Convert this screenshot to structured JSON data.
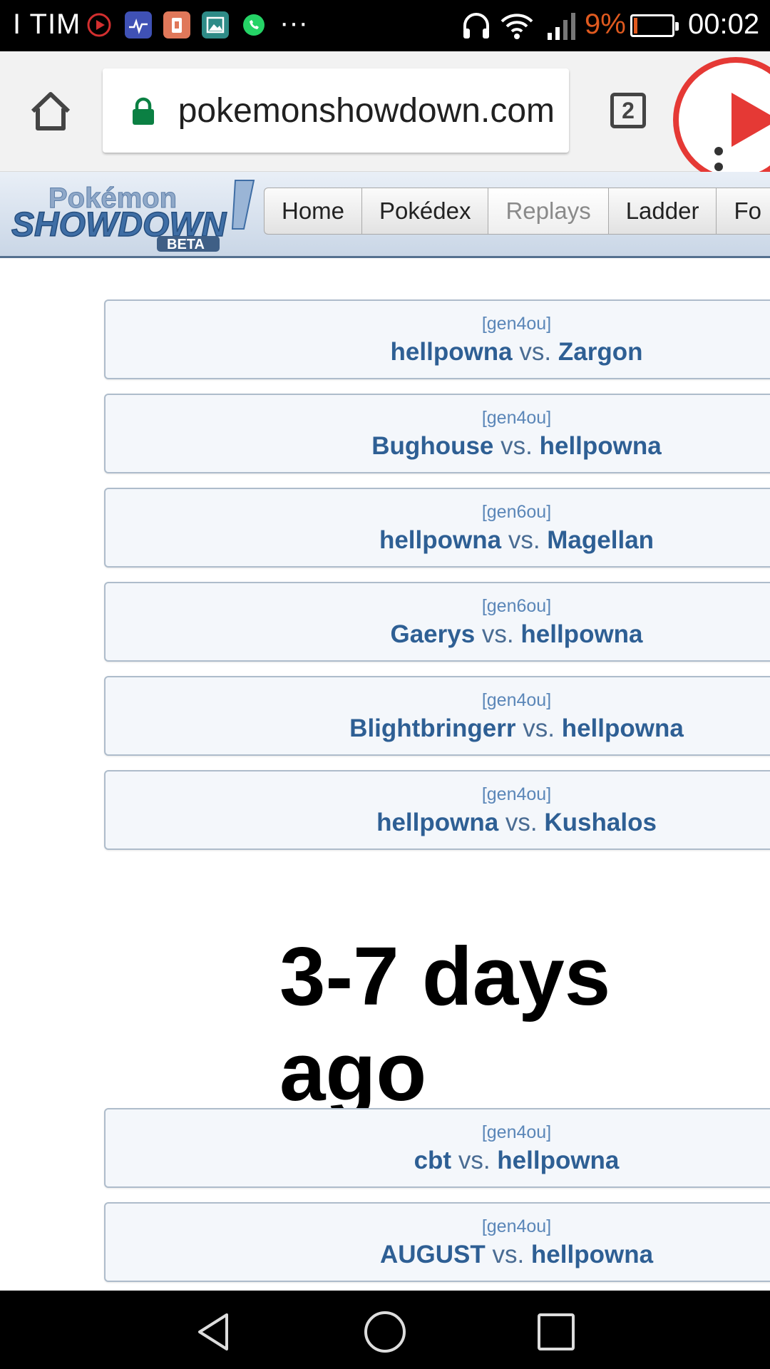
{
  "status_bar": {
    "carrier": "I TIM",
    "notification_icons": [
      "youtube-icon",
      "health-icon",
      "clipboard-icon",
      "gallery-icon",
      "whatsapp-icon"
    ],
    "more": "···",
    "battery_percent": "9%",
    "battery_level": 0.09,
    "time": "00:02"
  },
  "browser": {
    "url": "pokemonshowdown.com",
    "tab_count": "2"
  },
  "site": {
    "logo_text": "Pokémon Showdown! BETA",
    "nav": [
      "Home",
      "Pokédex",
      "Replays",
      "Ladder",
      "Fo"
    ]
  },
  "battles_recent": [
    {
      "format": "[gen4ou]",
      "p1": "hellpowna",
      "vs": "vs.",
      "p2": "Zargon"
    },
    {
      "format": "[gen4ou]",
      "p1": "Bughouse",
      "vs": "vs.",
      "p2": "hellpowna"
    },
    {
      "format": "[gen6ou]",
      "p1": "hellpowna",
      "vs": "vs.",
      "p2": "Magellan"
    },
    {
      "format": "[gen6ou]",
      "p1": "Gaerys",
      "vs": "vs.",
      "p2": "hellpowna"
    },
    {
      "format": "[gen4ou]",
      "p1": "Blightbringerr",
      "vs": "vs.",
      "p2": "hellpowna"
    },
    {
      "format": "[gen4ou]",
      "p1": "hellpowna",
      "vs": "vs.",
      "p2": "Kushalos"
    }
  ],
  "section_heading": "3-7 days ago",
  "battles_older": [
    {
      "format": "[gen4ou]",
      "p1": "cbt",
      "vs": "vs.",
      "p2": "hellpowna"
    },
    {
      "format": "[gen4ou]",
      "p1": "AUGUST",
      "vs": "vs.",
      "p2": "hellpowna"
    }
  ]
}
